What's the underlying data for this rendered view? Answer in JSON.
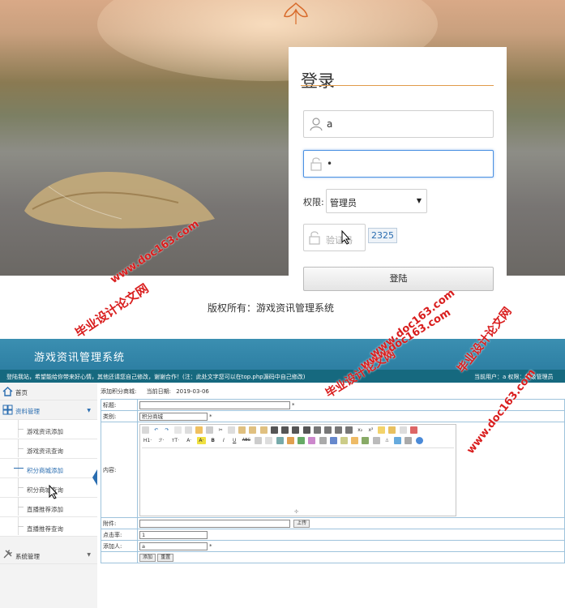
{
  "login": {
    "title": "登录",
    "username_value": "a",
    "password_value": "•",
    "role_label": "权限:",
    "role_selected": "管理员",
    "captcha_placeholder": "验证码",
    "captcha_code": "2325",
    "submit_label": "登陆",
    "copyright": "版权所有：游戏资讯管理系统"
  },
  "admin": {
    "system_title": "游戏资讯管理系统",
    "welcome_message": "登陆我站，希望能给你带来好心情，其他还请您自己修改，谢谢合作！(注：此处文字您可以在top.php源码中自己修改)",
    "current_user": "当前用户：a",
    "permission": "权限：超级管理员",
    "sidebar": {
      "home": "首页",
      "data_management": "资料管理",
      "sub_items": [
        "游戏资讯添加",
        "游戏资讯查询",
        "积分商城添加",
        "积分商城查询",
        "直播推荐添加",
        "直播推荐查询"
      ],
      "system_management": "系统管理"
    },
    "breadcrumb": "添加积分商城:",
    "date_label": "当前日期:",
    "date_value": "2019-03-06",
    "form": {
      "title_label": "标题:",
      "title_value": "",
      "category_label": "类别:",
      "category_value": "积分商城",
      "content_label": "内容:",
      "attachment_label": "附件:",
      "upload_button": "上传",
      "clicks_label": "点击率:",
      "clicks_value": "1",
      "added_by_label": "添加人:",
      "added_by_value": "a",
      "required_mark": "*",
      "add_button": "添加",
      "reset_button": "重置"
    },
    "editor_toolbar_row2_text": [
      "H1·",
      "ℱ·",
      "тT·",
      "A·",
      "A·",
      "B",
      "I",
      "U",
      "ABC"
    ]
  },
  "watermarks": {
    "brand": "毕业设计论文网",
    "url": "www.doc163.com"
  },
  "colors": {
    "accent_orange": "#e09a4a",
    "header_blue": "#2d7fa3",
    "bar_teal": "#16697f",
    "link_blue": "#2a6db0",
    "watermark_red": "#d91e1e"
  }
}
